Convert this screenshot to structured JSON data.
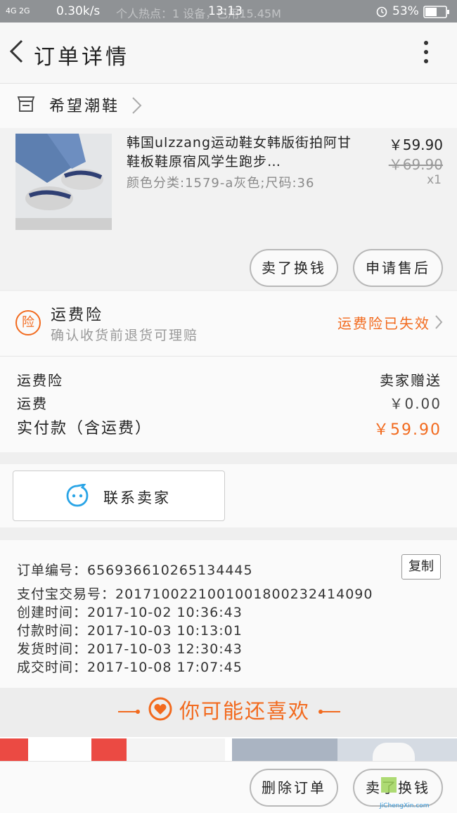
{
  "status_bar": {
    "network": "4G 2G",
    "speed": "0.30k/s",
    "hotspot": "个人热点：1 设备，已用15.45M",
    "time": "13:13",
    "battery": "53%"
  },
  "header": {
    "title": "订单详情"
  },
  "shop": {
    "name": "希望潮鞋"
  },
  "product": {
    "title": "韩国ulzzang运动鞋女韩版街拍阿甘鞋板鞋原宿风学生跑步…",
    "attributes": "颜色分类:1579-a灰色;尺码:36",
    "price": "￥59.90",
    "original_price": "￥69.90",
    "quantity": "x1",
    "buttons": {
      "sold_exchange": "卖了换钱",
      "after_sales": "申请售后"
    }
  },
  "insurance": {
    "badge": "险",
    "title": "运费险",
    "subtitle": "确认收货前退货可理赔",
    "status": "运费险已失效"
  },
  "fees": {
    "rows": [
      {
        "label": "运费险",
        "value": "卖家赠送"
      },
      {
        "label": "运费",
        "value": "￥0.00"
      },
      {
        "label": "实付款（含运费）",
        "value": "￥59.90"
      }
    ]
  },
  "contact": {
    "label": "联系卖家"
  },
  "order_info": {
    "order_no": "订单编号：656936610265134445",
    "copy_label": "复制",
    "alipay_no": "支付宝交易号：2017100221001001800232414090",
    "created": "创建时间：2017-10-02 10:36:43",
    "paid": "付款时间：2017-10-03 10:13:01",
    "shipped": "发货时间：2017-10-03 12:30:43",
    "completed": "成交时间：2017-10-08 17:07:45"
  },
  "recommend": {
    "title": "你可能还喜欢"
  },
  "bottom": {
    "delete": "删除订单",
    "sell": "卖了换钱"
  },
  "watermark": "JiChengXin.com",
  "colors": {
    "accent": "#f26a1e",
    "contact_icon": "#29a4e6"
  }
}
